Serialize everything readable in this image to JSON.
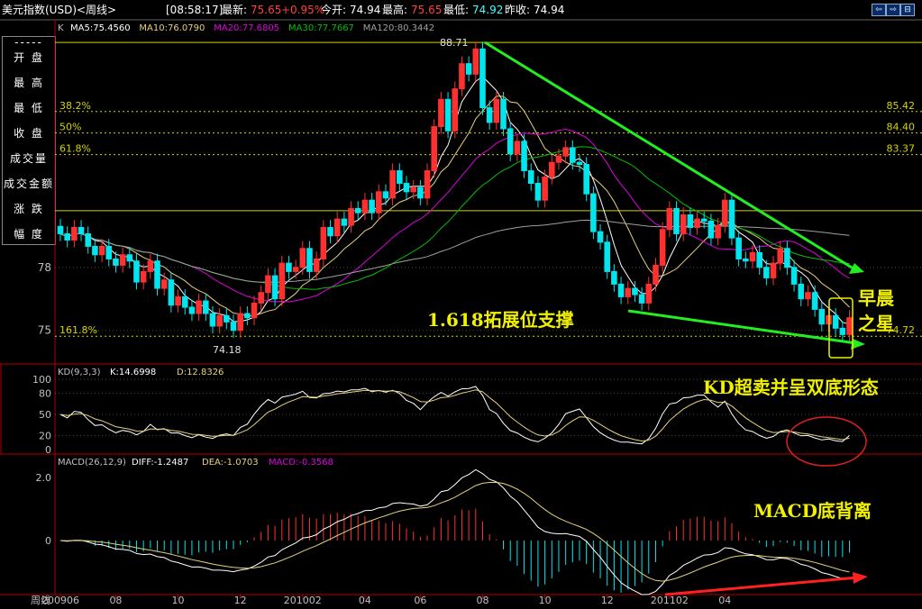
{
  "header": {
    "title": "美元指数(USD)<周线>",
    "time": "[08:58:17]",
    "latest_label": "最新:",
    "latest_value": "75.65",
    "change": "+0.95%",
    "open_label": "今开:",
    "open_value": "74.94",
    "high_label": "最高:",
    "high_value": "75.65",
    "low_label": "最低:",
    "low_value": "74.92",
    "prev_label": "昨收:",
    "prev_value": "74.94"
  },
  "window_buttons": [
    "⇦",
    "⇨",
    "⊟",
    "⊞"
  ],
  "side_panel": {
    "dash": "-----",
    "items": [
      "开  盘",
      "最  高",
      "最  低",
      "收  盘",
      "成交量",
      "成交金额",
      "涨  跌",
      "幅  度"
    ]
  },
  "colors": {
    "up": "#ff3030",
    "down": "#00e5ee",
    "ma5": "#ffffff",
    "ma10": "#e6d27a",
    "ma20": "#e000e0",
    "ma30": "#00c000",
    "ma120": "#a0a0a0",
    "green_line": "#22ee22",
    "red_line": "#ff2020",
    "fib": "#d4d400",
    "annot": "#f0f000",
    "axis": "#b00000"
  },
  "chart_data": [
    {
      "type": "candlestick",
      "ma_legend_prefix": "K",
      "ma_labels": [
        {
          "text": "MA5:75.4560",
          "color": "#ffffff"
        },
        {
          "text": "MA10:76.0790",
          "color": "#e6d27a"
        },
        {
          "text": "MA20:77.6805",
          "color": "#e000e0"
        },
        {
          "text": "MA30:77.7667",
          "color": "#00c000"
        },
        {
          "text": "MA120:80.3442",
          "color": "#a0a0a0"
        }
      ],
      "y_ticks": [
        "78",
        "75"
      ],
      "ylim": [
        74.0,
        88.8
      ],
      "x_labels": [
        "200906",
        "08",
        "10",
        "12",
        "201002",
        "04",
        "06",
        "08",
        "10",
        "12",
        "201102",
        "04"
      ],
      "closes": [
        79.6,
        79.3,
        79.9,
        79.6,
        79.0,
        78.6,
        79.0,
        78.4,
        78.1,
        78.6,
        78.3,
        77.3,
        77.8,
        78.3,
        77.0,
        77.4,
        76.2,
        76.6,
        76.1,
        75.8,
        76.4,
        75.8,
        75.2,
        75.7,
        75.4,
        75.0,
        75.8,
        75.6,
        76.3,
        76.8,
        77.6,
        76.5,
        78.2,
        77.8,
        78.0,
        78.9,
        77.8,
        78.4,
        79.9,
        79.5,
        80.3,
        80.0,
        80.8,
        80.6,
        81.2,
        80.6,
        81.6,
        81.3,
        82.6,
        82.0,
        81.6,
        81.8,
        81.3,
        82.6,
        84.7,
        86.0,
        84.5,
        86.5,
        87.7,
        87.2,
        88.4,
        85.6,
        84.9,
        86.0,
        84.6,
        83.4,
        84.0,
        82.6,
        82.0,
        81.2,
        82.3,
        83.0,
        83.3,
        83.7,
        83.0,
        82.9,
        81.5,
        79.7,
        79.2,
        77.8,
        77.2,
        76.6,
        77.0,
        76.7,
        76.3,
        77.2,
        78.1,
        79.8,
        80.8,
        79.6,
        80.5,
        79.9,
        80.3,
        80.2,
        79.4,
        80.0,
        81.2,
        79.4,
        78.4,
        78.3,
        78.7,
        78.0,
        77.5,
        78.2,
        78.9,
        78.0,
        77.2,
        76.5,
        76.8,
        76.0,
        75.3,
        75.7,
        75.1,
        74.8,
        75.6
      ],
      "annotations": {
        "high_label": "88.71",
        "low_label": "74.18",
        "fib_levels": [
          {
            "name": "38.2%",
            "value": 85.42,
            "value_label": "85.42"
          },
          {
            "name": "50%",
            "value": 84.4,
            "value_label": "84.40"
          },
          {
            "name": "61.8%",
            "value": 83.37,
            "value_label": "83.37"
          },
          {
            "name": "161.8%",
            "value": 74.72,
            "value_label": "74.72"
          }
        ],
        "ext_support": "1.618拓展位支撑",
        "morning_star_line1": "早晨",
        "morning_star_line2": "之星"
      }
    },
    {
      "type": "line",
      "legend": "KD(9,3,3)",
      "series": [
        {
          "name": "K",
          "value_label": "K:14.6998",
          "color": "#ffffff"
        },
        {
          "name": "D",
          "value_label": "D:12.8326",
          "color": "#e6d27a"
        }
      ],
      "y_ticks": [
        "100",
        "80",
        "50",
        "20",
        "0"
      ],
      "ylim": [
        0,
        100
      ],
      "annotation": "KD超卖并呈双底形态"
    },
    {
      "type": "bar",
      "legend": "MACD(26,12,9)",
      "diff_label": "DIFF:-1.2487",
      "dea_label": "DEA:-1.0703",
      "macd_label": "MACD:-0.3568",
      "y_ticks": [
        "2.0",
        "0"
      ],
      "annotation": "MACD底背离"
    }
  ],
  "footer": {
    "period_label": "周线"
  }
}
